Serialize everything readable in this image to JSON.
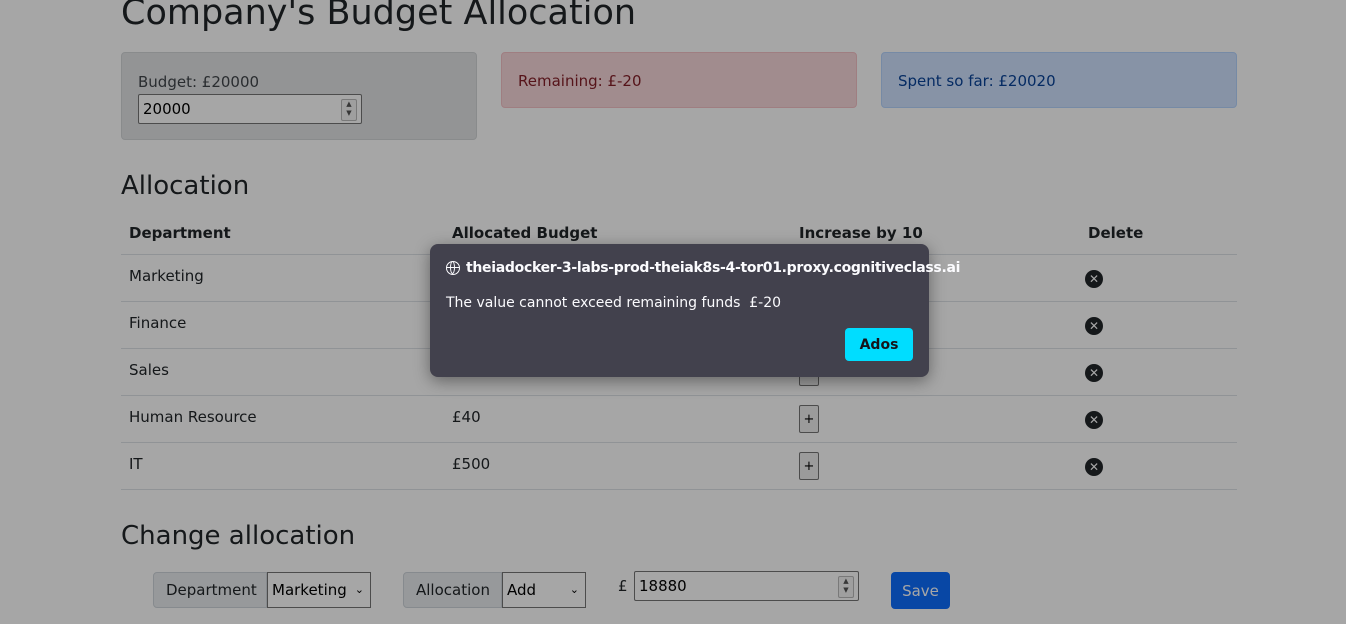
{
  "page": {
    "title": "Company's Budget Allocation"
  },
  "cards": {
    "budget_label": "Budget: £20000",
    "budget_value": "20000",
    "remaining": "Remaining: £-20",
    "spent": "Spent so far: £20020"
  },
  "allocation": {
    "title": "Allocation",
    "headers": [
      "Department",
      "Allocated Budget",
      "Increase by 10",
      "Delete"
    ],
    "rows": [
      {
        "department": "Marketing",
        "budget": ""
      },
      {
        "department": "Finance",
        "budget": ""
      },
      {
        "department": "Sales",
        "budget": ""
      },
      {
        "department": "Human Resource",
        "budget": "£40"
      },
      {
        "department": "IT",
        "budget": "£500"
      }
    ],
    "increase_label": "+",
    "delete_icon": "x-circle-icon"
  },
  "change": {
    "title": "Change allocation",
    "department_label": "Department",
    "department_value": "Marketing",
    "allocation_label": "Allocation",
    "allocation_value": "Add",
    "currency": "£",
    "amount": "18880",
    "save_label": "Save"
  },
  "dialog": {
    "origin": "theiadocker-3-labs-prod-theiak8s-4-tor01.proxy.cognitiveclass.ai",
    "message": "The value cannot exceed remaining funds  £-20",
    "ok_label": "Ados"
  },
  "colors": {
    "remaining_bg": "#f8d7da",
    "spent_bg": "#cfe2ff",
    "budget_bg": "#e2e3e5",
    "save_bg": "#0d6efd",
    "dialog_bg": "#42414d",
    "dialog_button": "#00ddff"
  }
}
